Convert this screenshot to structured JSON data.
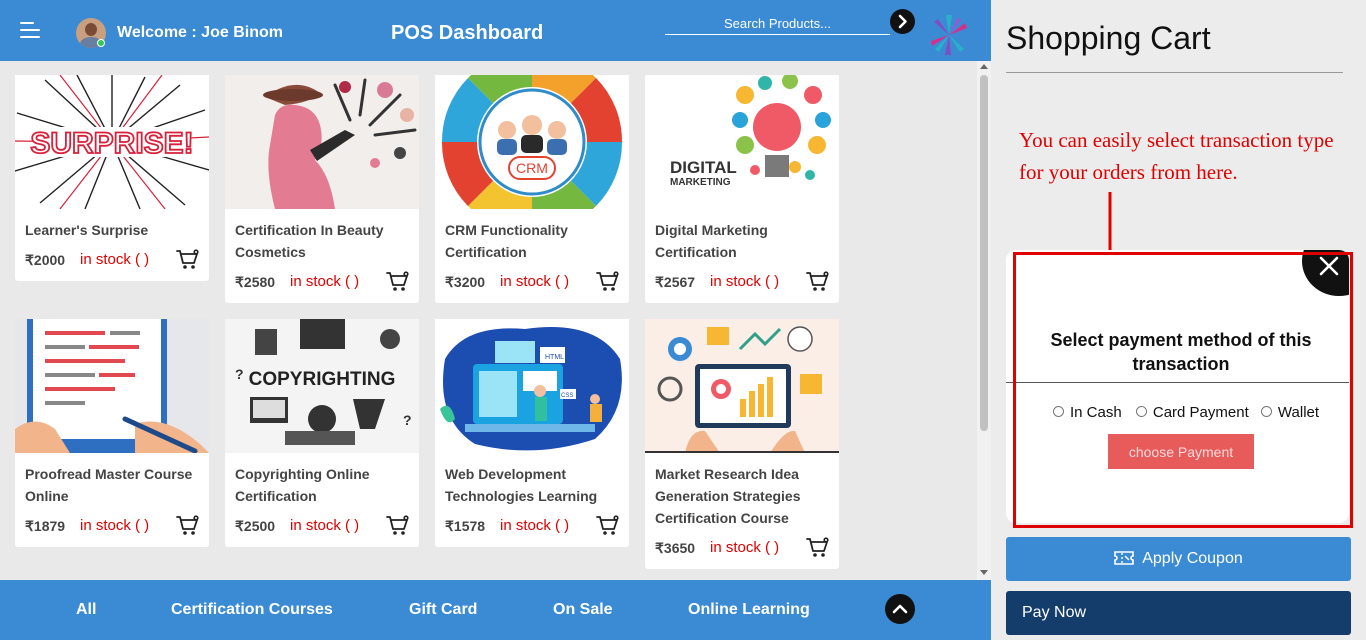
{
  "header": {
    "welcome": "Welcome : Joe Binom",
    "title": "POS Dashboard",
    "search_placeholder": "Search Products...",
    "icons": [
      "hamburger-icon",
      "avatar",
      "arrow-right-icon",
      "logo"
    ]
  },
  "products": [
    {
      "name": "Learner's Surprise",
      "price": "₹2000",
      "stock": "in stock ( )"
    },
    {
      "name": "Certification In Beauty Cosmetics",
      "price": "₹2580",
      "stock": "in stock ( )"
    },
    {
      "name": "CRM Functionality Certification",
      "price": "₹3200",
      "stock": "in stock ( )"
    },
    {
      "name": "Digital Marketing Certification",
      "price": "₹2567",
      "stock": "in stock ( )"
    },
    {
      "name": "Proofread Master Course Online",
      "price": "₹1879",
      "stock": "in stock ( )"
    },
    {
      "name": "Copyrighting Online Certification",
      "price": "₹2500",
      "stock": "in stock ( )"
    },
    {
      "name": "Web Development Technologies Learning",
      "price": "₹1578",
      "stock": "in stock ( )"
    },
    {
      "name": "Market Research Idea Generation Strategies Certification Course",
      "price": "₹3650",
      "stock": "in stock ( )"
    }
  ],
  "image_text": {
    "surprise": "SURPRISE!",
    "crm": "CRM",
    "digital": "DIGITAL",
    "marketing": "MARKETING",
    "copyrighting": "COPYRIGHTING",
    "html": "HTML",
    "css": "CSS"
  },
  "footer": {
    "categories": [
      "All",
      "Certification Courses",
      "Gift Card",
      "On Sale",
      "Online Learning"
    ]
  },
  "cart": {
    "title": "Shopping Cart",
    "annotation": "You can easily select transaction type for your orders from here.",
    "modal_heading": "Select payment method of this transaction",
    "options": [
      "In Cash",
      "Card Payment",
      "Wallet"
    ],
    "choose_label": "choose Payment",
    "coupon_label": "Apply Coupon",
    "paynow_label": "Pay Now"
  },
  "colors": {
    "primary": "#3a8bd4",
    "dark_button": "#153d6b",
    "stock_red": "#e00000",
    "choose_button": "#e85b5b"
  }
}
